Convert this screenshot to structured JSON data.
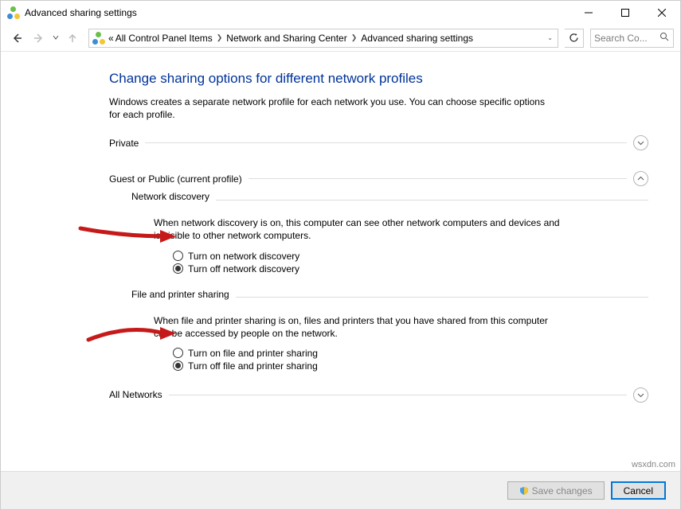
{
  "window": {
    "title": "Advanced sharing settings"
  },
  "breadcrumb": {
    "prefix": "«",
    "items": [
      "All Control Panel Items",
      "Network and Sharing Center",
      "Advanced sharing settings"
    ]
  },
  "search": {
    "placeholder": "Search Co..."
  },
  "page": {
    "title": "Change sharing options for different network profiles",
    "description": "Windows creates a separate network profile for each network you use. You can choose specific options for each profile."
  },
  "sections": {
    "private": {
      "title": "Private"
    },
    "guest": {
      "title": "Guest or Public (current profile)",
      "network_discovery": {
        "title": "Network discovery",
        "desc": "When network discovery is on, this computer can see other network computers and devices and is visible to other network computers.",
        "opt_on": "Turn on network discovery",
        "opt_off": "Turn off network discovery"
      },
      "file_printer": {
        "title": "File and printer sharing",
        "desc": "When file and printer sharing is on, files and printers that you have shared from this computer can be accessed by people on the network.",
        "opt_on": "Turn on file and printer sharing",
        "opt_off": "Turn off file and printer sharing"
      }
    },
    "all": {
      "title": "All Networks"
    }
  },
  "footer": {
    "save": "Save changes",
    "cancel": "Cancel"
  },
  "watermark": "wsxdn.com"
}
